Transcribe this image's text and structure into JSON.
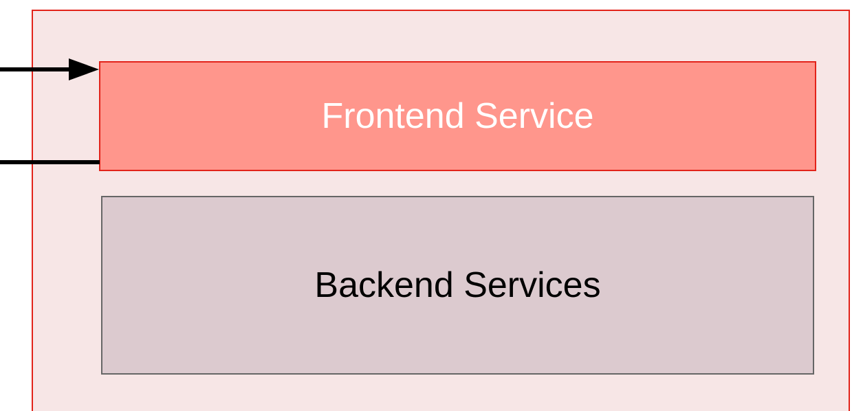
{
  "diagram": {
    "frontend_label": "Frontend Service",
    "backend_label": "Backend Services"
  },
  "colors": {
    "container_border": "#e2231a",
    "container_fill": "#f7e6e6",
    "frontend_fill": "#ff968c",
    "frontend_text": "#ffffff",
    "backend_fill": "#dccacf",
    "backend_border": "#666666",
    "arrow": "#000000"
  }
}
